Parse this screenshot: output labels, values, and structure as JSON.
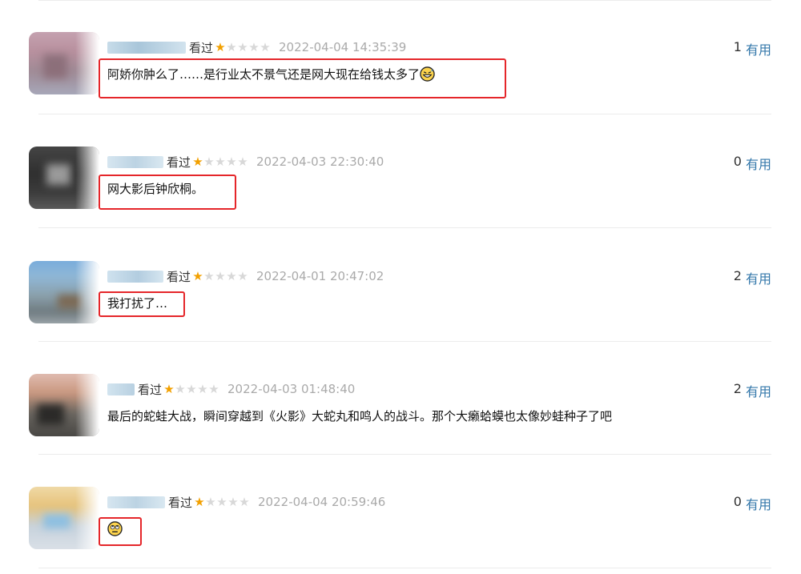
{
  "vote_label": "有用",
  "comments": [
    {
      "status": "看过",
      "rating_stars": 1,
      "rating_max": 5,
      "time": "2022-04-04 14:35:39",
      "text": "阿娇你肿么了……是行业太不景气还是网大现在给钱太多了",
      "trailing_emoji": "grinning-sweat-emoji",
      "votes": "1"
    },
    {
      "status": "看过",
      "rating_stars": 1,
      "rating_max": 5,
      "time": "2022-04-03 22:30:40",
      "text": "网大影后钟欣桐。",
      "votes": "0"
    },
    {
      "status": "看过",
      "rating_stars": 1,
      "rating_max": 5,
      "time": "2022-04-01 20:47:02",
      "text": "我打扰了…",
      "votes": "2"
    },
    {
      "status": "看过",
      "rating_stars": 1,
      "rating_max": 5,
      "time": "2022-04-03 01:48:40",
      "text": "最后的蛇蛙大战，瞬间穿越到《火影》大蛇丸和鸣人的战斗。那个大癞蛤蟆也太像妙蛙种子了吧",
      "votes": "2"
    },
    {
      "status": "看过",
      "rating_stars": 1,
      "rating_max": 5,
      "time": "2022-04-04 20:59:46",
      "text": "",
      "trailing_emoji": "rolling-eyes-emoji",
      "votes": "0"
    }
  ],
  "colors": {
    "star_on": "#f2a000",
    "star_off": "#d8d8d8",
    "link": "#3377aa",
    "highlight": "#e5262a"
  }
}
